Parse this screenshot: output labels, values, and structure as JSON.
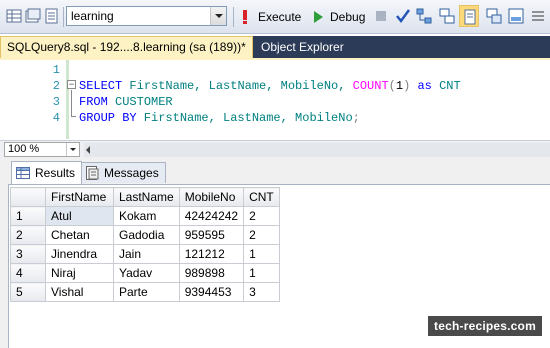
{
  "toolbar": {
    "database": "learning",
    "execute_label": "Execute",
    "debug_label": "Debug"
  },
  "tabs": {
    "query_tab": "SQLQuery8.sql - 192....8.learning (sa (189))*",
    "object_explorer": "Object Explorer"
  },
  "editor": {
    "line_numbers": [
      "1",
      "2",
      "3",
      "4"
    ],
    "lines": [
      {
        "select_kw": "SELECT",
        "cols": " FirstName, LastName, MobileNo, ",
        "fn": "COUNT",
        "open": "(",
        "arg": "1",
        "close": ")",
        "as_kw": " as",
        "alias": " CNT"
      },
      {
        "from_kw": "FROM",
        "table": " CUSTOMER"
      },
      {
        "group_kw": "GROUP BY",
        "cols": " FirstName, LastName, MobileNo",
        "semi": ";"
      }
    ]
  },
  "zoom": "100 %",
  "results": {
    "tabs": [
      "Results",
      "Messages"
    ],
    "columns": [
      "FirstName",
      "LastName",
      "MobileNo",
      "CNT"
    ],
    "rows": [
      {
        "n": "1",
        "FirstName": "Atul",
        "LastName": "Kokam",
        "MobileNo": "42424242",
        "CNT": "2"
      },
      {
        "n": "2",
        "FirstName": "Chetan",
        "LastName": "Gadodia",
        "MobileNo": "959595",
        "CNT": "2"
      },
      {
        "n": "3",
        "FirstName": "Jinendra",
        "LastName": "Jain",
        "MobileNo": "121212",
        "CNT": "1"
      },
      {
        "n": "4",
        "FirstName": "Niraj",
        "LastName": "Yadav",
        "MobileNo": "989898",
        "CNT": "1"
      },
      {
        "n": "5",
        "FirstName": "Vishal",
        "LastName": "Parte",
        "MobileNo": "9394453",
        "CNT": "3"
      }
    ]
  },
  "watermark": "tech-recipes.com",
  "colors": {
    "keyword": "#0000ff",
    "function": "#ff00ff",
    "identifier": "#008080",
    "tab_bar": "#2b3b58",
    "active_tab": "#fcf2c3"
  }
}
